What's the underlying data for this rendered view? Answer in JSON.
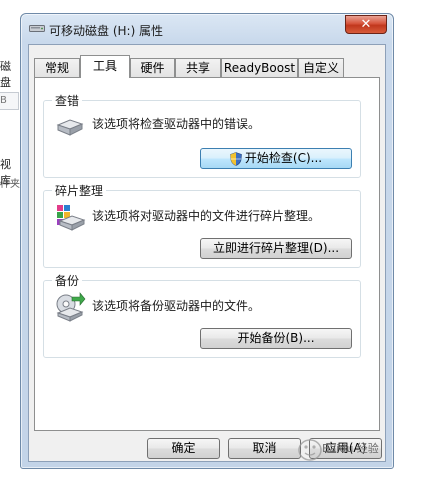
{
  "background_window": {
    "fragment_1": "磁盘",
    "fragment_2": "B",
    "fragment_3": "视库",
    "fragment_4": "件夹"
  },
  "window": {
    "title": "可移动磁盘 (H:) 属性",
    "close_label": "✕"
  },
  "tabs": [
    {
      "label": "常规"
    },
    {
      "label": "工具"
    },
    {
      "label": "硬件"
    },
    {
      "label": "共享"
    },
    {
      "label": "ReadyBoost"
    },
    {
      "label": "自定义"
    }
  ],
  "active_tab": "工具",
  "groups": {
    "error_check": {
      "title": "查错",
      "description": "该选项将检查驱动器中的错误。",
      "button": "开始检查(C)..."
    },
    "defrag": {
      "title": "碎片整理",
      "description": "该选项将对驱动器中的文件进行碎片整理。",
      "button": "立即进行碎片整理(D)..."
    },
    "backup": {
      "title": "备份",
      "description": "该选项将备份驱动器中的文件。",
      "button": "开始备份(B)..."
    }
  },
  "footer": {
    "ok": "确定",
    "cancel": "取消",
    "apply": "应用(A)"
  },
  "watermark": {
    "text": "Baidu 经验"
  },
  "colors": {
    "accent": "#3c7fb1",
    "close_button": "#c1371d",
    "frame": "#c3d4e8"
  }
}
